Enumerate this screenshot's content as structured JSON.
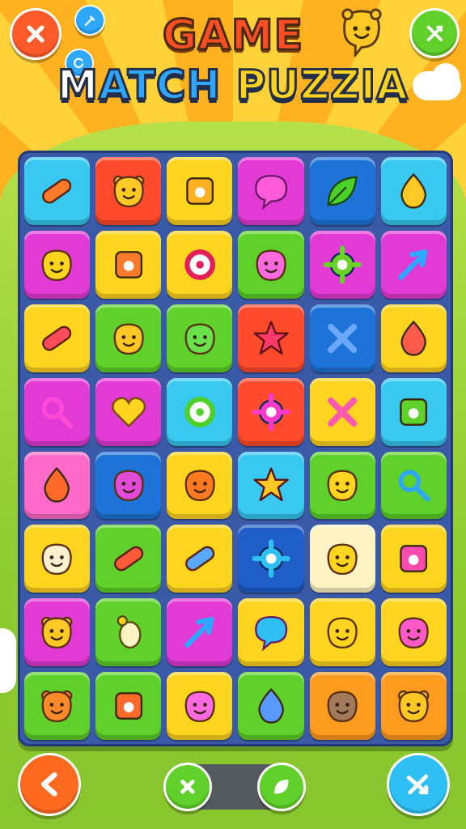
{
  "title": {
    "line1": "GAME",
    "line2_a": "M",
    "line2_b": "ATCH",
    "line2_c": " PUZZIA"
  },
  "colors": {
    "red": "#ff4b2b",
    "yellow": "#ffd51f",
    "green": "#5fd12a",
    "blue": "#1e73d8",
    "cyan": "#38c8f0",
    "magenta": "#e23ad4",
    "pink": "#ff6ac8",
    "orange": "#ff9b1f",
    "cream": "#fff3c4",
    "darkblue": "#1f5dc8"
  },
  "top_buttons": {
    "close": "close-icon",
    "settings": "wrench-icon",
    "refresh": "refresh-icon",
    "mascot": "mascot-icon",
    "shuffle": "shuffle-icon"
  },
  "bottom_buttons": {
    "back": "back-arrow-icon",
    "cancel": "close-icon",
    "hint": "leaf-icon",
    "share": "shuffle-icon"
  },
  "board": [
    [
      "cyan",
      "red",
      "yellow",
      "magenta",
      "blue",
      "cyan"
    ],
    [
      "magenta",
      "yellow",
      "yellow",
      "green",
      "magenta",
      "magenta"
    ],
    [
      "yellow",
      "green",
      "green",
      "red",
      "blue",
      "yellow"
    ],
    [
      "magenta",
      "magenta",
      "cyan",
      "red",
      "yellow",
      "cyan"
    ],
    [
      "pink",
      "blue",
      "yellow",
      "cyan",
      "green",
      "green"
    ],
    [
      "yellow",
      "green",
      "yellow",
      "darkblue",
      "cream",
      "yellow"
    ],
    [
      "magenta",
      "green",
      "magenta",
      "yellow",
      "yellow",
      "yellow"
    ],
    [
      "green",
      "green",
      "yellow",
      "green",
      "orange",
      "orange"
    ]
  ],
  "board_icons": [
    [
      "hotdog-icon",
      "bear-face-icon",
      "note-icon",
      "speech-bubble-icon",
      "leaf-icon",
      "pear-icon"
    ],
    [
      "cat-face-icon",
      "camera-icon",
      "record-icon",
      "smiley-icon",
      "bug-icon",
      "arrow-icon"
    ],
    [
      "thermometer-icon",
      "owl-icon",
      "frog-icon",
      "star-icon",
      "cross-icon",
      "balloon-icon"
    ],
    [
      "magnifier-icon",
      "heart-icon",
      "link-icon",
      "germ-icon",
      "x-icon",
      "document-icon"
    ],
    [
      "lollipop-icon",
      "ghost-icon",
      "orange-face-icon",
      "star-face-icon",
      "chick-icon",
      "hand-mirror-icon"
    ],
    [
      "hen-face-icon",
      "rocket-icon",
      "pen-icon",
      "gear-icon",
      "chick-icon",
      "ticket-icon"
    ],
    [
      "bear-face-icon",
      "egg-icon",
      "brush-icon",
      "phone-icon",
      "chick-icon",
      "blob-icon"
    ],
    [
      "fox-face-icon",
      "house-icon",
      "smiley-icon",
      "slime-icon",
      "bird-icon",
      "bear-face-icon"
    ]
  ]
}
